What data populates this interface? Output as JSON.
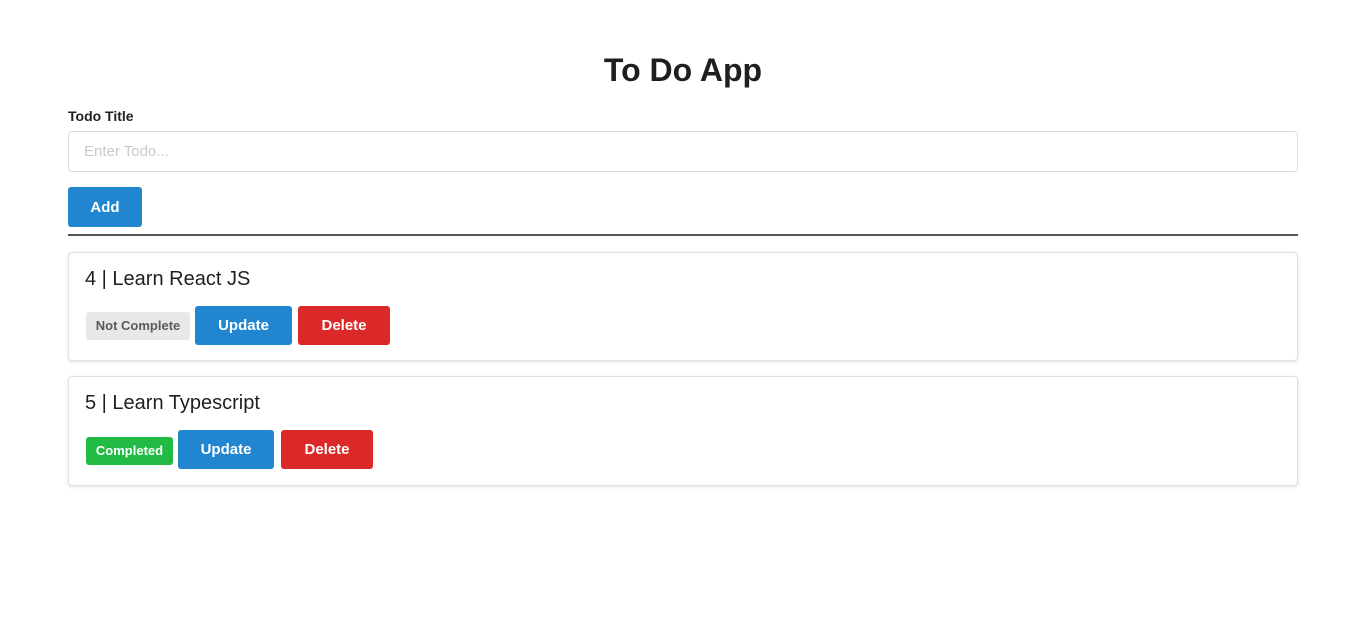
{
  "header": {
    "title": "To Do App"
  },
  "form": {
    "label": "Todo Title",
    "input_value": "",
    "placeholder": "Enter Todo...",
    "add_label": "Add"
  },
  "todos": [
    {
      "title": "4 | Learn React JS",
      "status": "Not Complete",
      "update_label": "Update",
      "delete_label": "Delete"
    },
    {
      "title": "5 | Learn Typescript",
      "status": "Completed",
      "update_label": "Update",
      "delete_label": "Delete"
    }
  ],
  "colors": {
    "primary": "#2185d0",
    "danger": "#db2828",
    "completed": "#21ba45",
    "not_complete": "#e8e8e8"
  }
}
